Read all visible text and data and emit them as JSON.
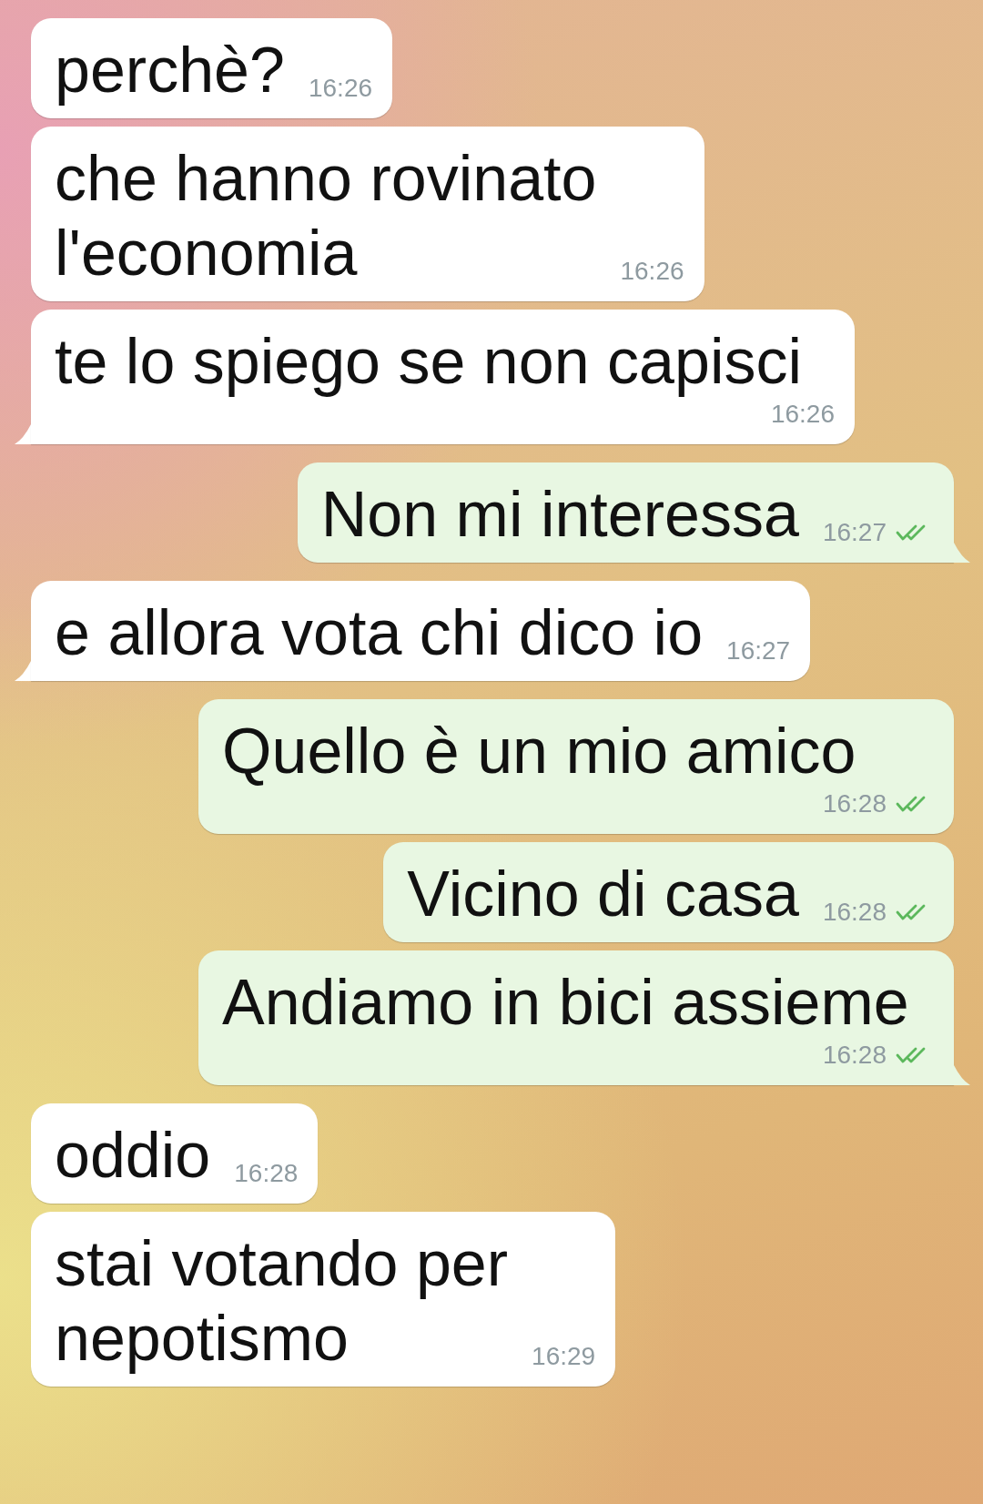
{
  "messages": [
    {
      "kind": "in",
      "lines": [
        "perchè?"
      ],
      "time": "16:26",
      "tail": false
    },
    {
      "kind": "in",
      "lines": [
        "che hanno rovinato",
        "l'economia"
      ],
      "time": "16:26",
      "tail": false
    },
    {
      "kind": "in",
      "lines": [
        "te lo spiego se non capisci"
      ],
      "time": "16:26",
      "tail": true
    },
    {
      "kind": "out",
      "lines": [
        "Non mi interessa"
      ],
      "time": "16:27",
      "tail": true,
      "read": true
    },
    {
      "kind": "in",
      "lines": [
        "e allora vota chi dico io"
      ],
      "time": "16:27",
      "tail": true
    },
    {
      "kind": "out",
      "lines": [
        "Quello è un mio amico"
      ],
      "time": "16:28",
      "tail": false,
      "read": true
    },
    {
      "kind": "out",
      "lines": [
        "Vicino di casa"
      ],
      "time": "16:28",
      "tail": false,
      "read": true
    },
    {
      "kind": "out",
      "lines": [
        "Andiamo in bici assieme"
      ],
      "time": "16:28",
      "tail": true,
      "read": true
    },
    {
      "kind": "in",
      "lines": [
        "oddio"
      ],
      "time": "16:28",
      "tail": false
    },
    {
      "kind": "in",
      "lines": [
        "stai votando per",
        "nepotismo"
      ],
      "time": "16:29",
      "tail": false
    }
  ]
}
